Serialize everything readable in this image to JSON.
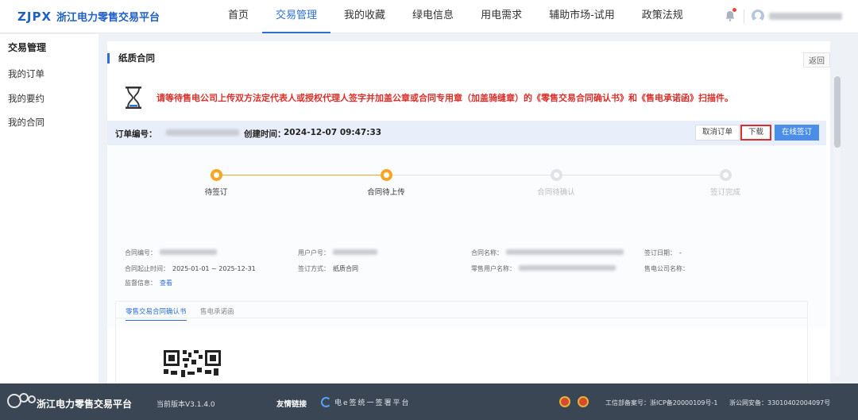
{
  "header": {
    "logo_mark": "ZJPX",
    "logo_text": "浙江电力零售交易平台",
    "nav": [
      "首页",
      "交易管理",
      "我的收藏",
      "绿电信息",
      "用电需求",
      "辅助市场-试用",
      "政策法规"
    ],
    "active_nav_index": 1
  },
  "sidebar": {
    "title": "交易管理",
    "items": [
      "我的订单",
      "我的要约",
      "我的合同"
    ]
  },
  "card": {
    "title": "纸质合同",
    "back": "返回",
    "notice": "请等待售电公司上传双方法定代表人或授权代理人签字并加盖公章或合同专用章（加盖骑缝章）的《零售交易合同确认书》和《售电承诺函》扫描件。"
  },
  "order": {
    "number_label": "订单编号：",
    "created_label": "创建时间：",
    "created_value": "2024-12-07 09:47:33",
    "buttons": {
      "cancel": "取消订单",
      "download": "下载",
      "sign": "在线签订"
    }
  },
  "steps": [
    {
      "label": "待签订",
      "done": true
    },
    {
      "label": "合同待上传",
      "done": true
    },
    {
      "label": "合同待确认",
      "done": false
    },
    {
      "label": "签订完成",
      "done": false
    }
  ],
  "info": {
    "contract_no": "合同编号：",
    "user_no": "用户户号：",
    "contract_name": "合同名称：",
    "sign_date": "签订日期：",
    "sign_date_value": "-",
    "period": "合同起止时间：",
    "period_value": "2025-01-01 ~ 2025-12-31",
    "sign_method": "签订方式：",
    "sign_method_value": "纸质合同",
    "retail_user": "零售用户名称：",
    "seller": "售电公司名称：",
    "supervision": "监督信息：",
    "supervision_link": "查看"
  },
  "tabs": [
    "零售交易合同确认书",
    "售电承诺函"
  ],
  "active_tab_index": 0,
  "footer": {
    "brand": "浙江电力零售交易平台",
    "version": "当前版本V3.1.4.0",
    "links": "友情链接",
    "esign": "电e签统一签署平台",
    "icp": "工信部备案号：浙ICP备20000109号-1",
    "police": "浙公网安备：33010402004097号"
  },
  "colors": {
    "accent": "#2f6fd1",
    "warning": "#d9302b",
    "step_done": "#f5a623",
    "footer_bg": "#3b4654"
  }
}
